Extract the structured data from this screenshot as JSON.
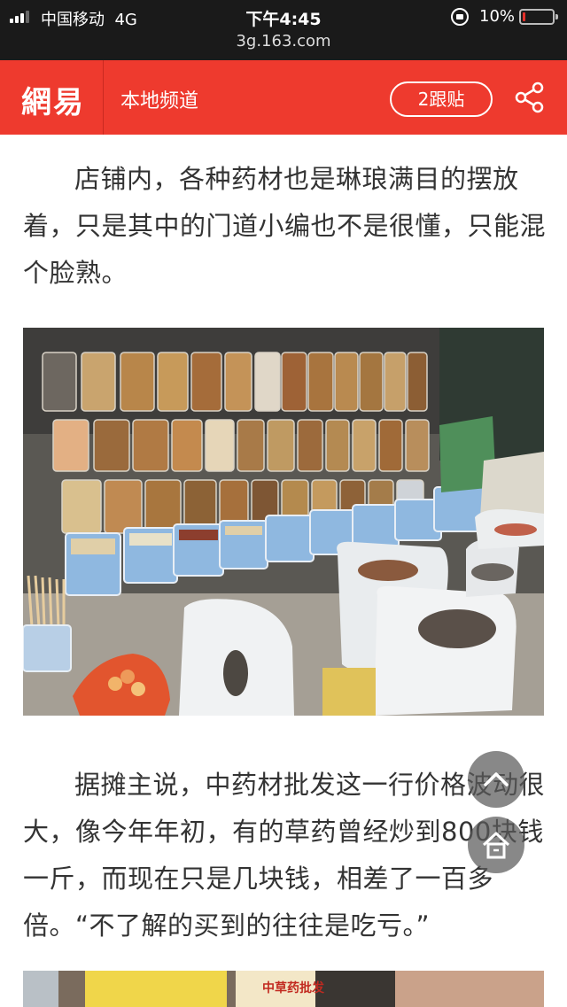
{
  "status_bar": {
    "carrier": "中国移动",
    "network": "4G",
    "time": "下午4:45",
    "battery": "10%",
    "battery_level": 0.1,
    "url": "3g.163.com"
  },
  "header": {
    "logo": "網易",
    "channel": "本地频道",
    "follow_label": "2跟贴",
    "brand_color": "#ee3a2e"
  },
  "article": {
    "paragraphs": [
      "店铺内，各种药材也是琳琅满目的摆放着，只是其中的门道小编也不是很懂，只能混个脸熟。",
      "据摊主说，中药材批发这一行价格波动很大，像今年年初，有的草药曾经炒到800块钱一斤，而现在只是几块钱，相差了一百多倍。“不了解的买到的往往是吃亏。”"
    ],
    "photo_sign_texts": [
      "中草药批发"
    ]
  },
  "icons": {
    "share": "share-icon",
    "scroll_top": "chevron-up-icon",
    "home": "home-icon",
    "lock": "rotation-lock-icon",
    "signal": "signal-icon",
    "battery": "battery-icon"
  }
}
